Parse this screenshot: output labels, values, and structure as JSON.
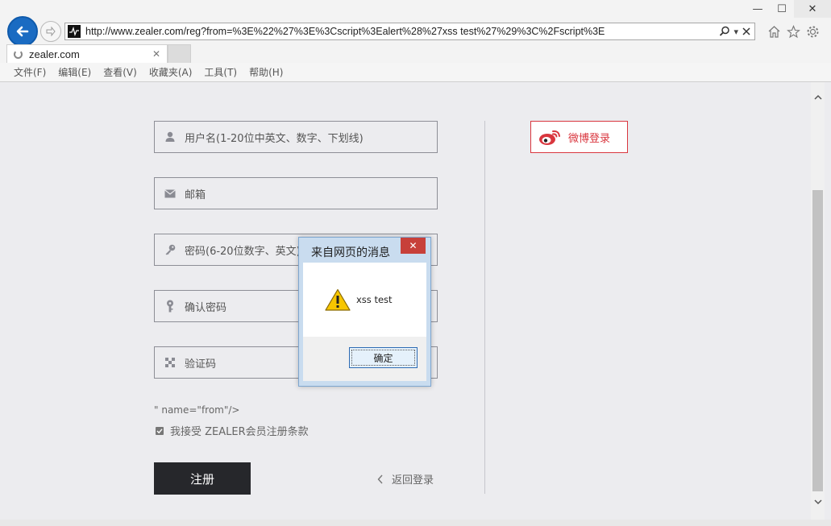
{
  "browser": {
    "url": "http://www.zealer.com/reg?from=%3E%22%27%3E%3Cscript%3Ealert%28%27xss test%27%29%3C%2Fscript%3E",
    "tab_title": "zealer.com",
    "window_controls": [
      "—",
      "☐",
      "✕"
    ],
    "menu": [
      "文件(F)",
      "编辑(E)",
      "查看(V)",
      "收藏夹(A)",
      "工具(T)",
      "帮助(H)"
    ]
  },
  "form": {
    "username_placeholder": "用户名(1-20位中英文、数字、下划线)",
    "email_placeholder": "邮箱",
    "password_placeholder": "密码(6-20位数字、英文)",
    "confirm_placeholder": "确认密码",
    "captcha_placeholder": "验证码",
    "leaked_text": "\" name=\"from\"/>",
    "agree_label": "我接受 ZEALER会员注册条款",
    "register_label": "注册",
    "back_login_label": "返回登录",
    "weibo_login_label": "微博登录"
  },
  "dialog": {
    "title": "来自网页的消息",
    "message": "xss test",
    "ok_label": "确定"
  },
  "colors": {
    "accent_blue": "#1a6bc2",
    "weibo_red": "#d9363e",
    "button_dark": "#26272b",
    "dialog_frame": "#c9dcef"
  }
}
